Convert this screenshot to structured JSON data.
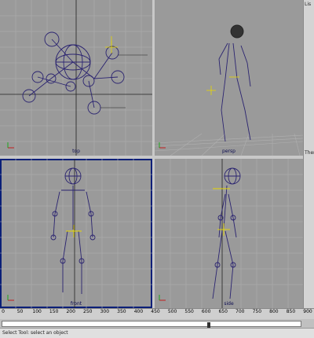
{
  "viewports": {
    "top": {
      "label": "top"
    },
    "persp": {
      "label": "persp"
    },
    "front": {
      "label": "front"
    },
    "side": {
      "label": "side"
    }
  },
  "side_panel": {
    "list_label": "Lis",
    "there_label": "There"
  },
  "timeline": {
    "ticks": [
      "0",
      "50",
      "100",
      "150",
      "200",
      "250",
      "300",
      "350",
      "400",
      "450",
      "500",
      "550",
      "600",
      "650",
      "700",
      "750",
      "800",
      "850",
      "900"
    ],
    "current_frame": 625
  },
  "help_line": {
    "text": "Select Tool: select an object"
  },
  "colors": {
    "viewport_bg": "#9a9a9a",
    "grid": "#b0b0b0",
    "skeleton": "#2a2370",
    "joint_selected": "#e8d800",
    "active_border": "#0a1f78"
  }
}
